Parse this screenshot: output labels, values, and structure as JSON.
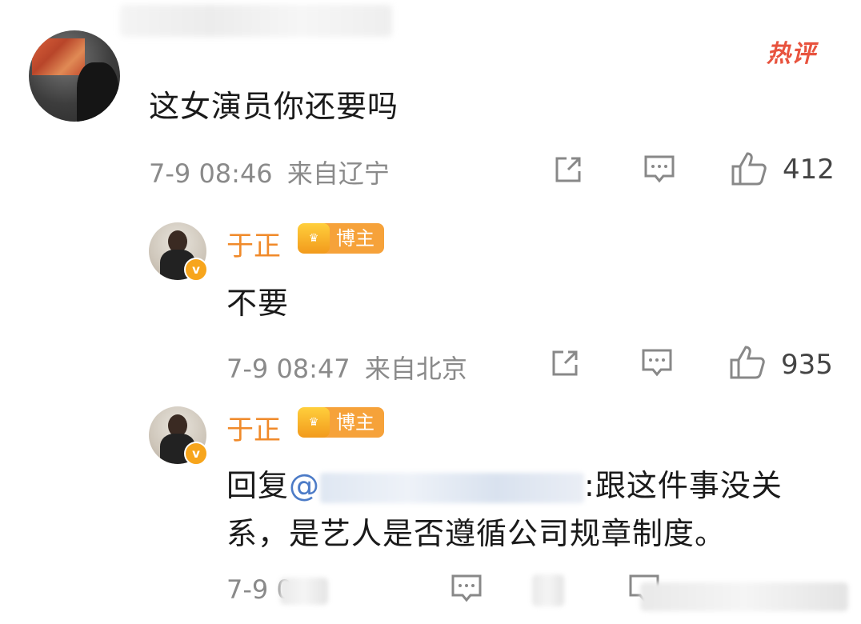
{
  "hot_label": "热评",
  "main_comment": {
    "text": "这女演员你还要吗",
    "time": "7-9 08:46",
    "location": "来自辽宁",
    "likes": "412"
  },
  "replies": [
    {
      "username": "于正",
      "badge": "博主",
      "text": "不要",
      "time": "7-9 08:47",
      "location": "来自北京",
      "likes": "935"
    },
    {
      "username": "于正",
      "badge": "博主",
      "reply_prefix": "回复",
      "mention_prefix": "@",
      "text_line1": ":跟这件事没关",
      "text_line2": "系，是艺人是否遵循公司规章制度。",
      "time": "7-9 0"
    }
  ],
  "icons": {
    "share": "share-icon",
    "comment": "comment-icon",
    "like": "thumbs-up-icon",
    "verified": "verified-v-icon",
    "crown": "crown-icon"
  },
  "colors": {
    "username": "#f08a2a",
    "mention": "#4c7bc7",
    "hot": "#e8533e",
    "badge": "#f6a23a"
  }
}
